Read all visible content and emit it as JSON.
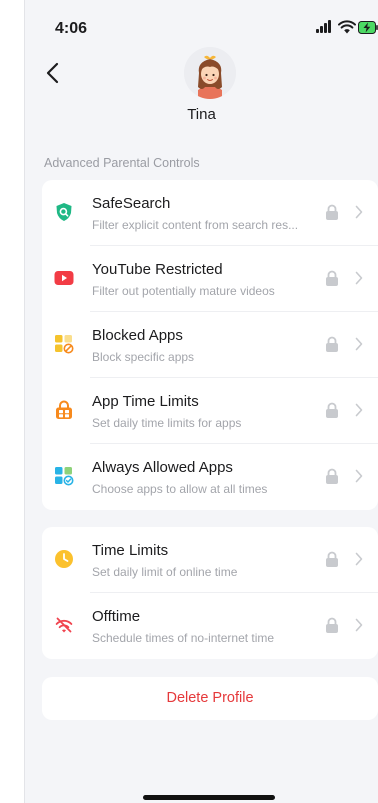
{
  "status_bar": {
    "time": "4:06",
    "icons": [
      "signal-icon",
      "wifi-icon",
      "battery-charging-icon"
    ]
  },
  "header": {
    "back_icon": "chevron-left-icon",
    "avatar": "girl-avatar-icon",
    "profile_name": "Tina"
  },
  "advanced": {
    "title": "Advanced Parental Controls",
    "items": [
      {
        "title": "SafeSearch",
        "subtitle": "Filter explicit content from search res...",
        "icon": "safesearch-shield-icon",
        "color": "#1fb885"
      },
      {
        "title": "YouTube Restricted",
        "subtitle": "Filter out potentially mature videos",
        "icon": "youtube-play-icon",
        "color": "#f23c45"
      },
      {
        "title": "Blocked Apps",
        "subtitle": "Block specific apps",
        "icon": "blocked-apps-icon",
        "color": "#f5c32d"
      },
      {
        "title": "App Time Limits",
        "subtitle": "Set daily time limits for apps",
        "icon": "app-time-limit-icon",
        "color": "#f78a1d"
      },
      {
        "title": "Always Allowed Apps",
        "subtitle": "Choose apps to allow at all times",
        "icon": "allowed-apps-icon",
        "color": "#28b3e6"
      }
    ]
  },
  "time_section": {
    "items": [
      {
        "title": "Time Limits",
        "subtitle": "Set daily limit of online time",
        "icon": "clock-icon",
        "color": "#fbc12d"
      },
      {
        "title": "Offtime",
        "subtitle": "Schedule times of no-internet time",
        "icon": "no-wifi-icon",
        "color": "#f0444f"
      }
    ]
  },
  "row_accessories": {
    "lock_icon": "lock-icon",
    "chevron_icon": "chevron-right-icon",
    "color": "#c8cace"
  },
  "delete": {
    "label": "Delete Profile",
    "color": "#e5393b"
  }
}
